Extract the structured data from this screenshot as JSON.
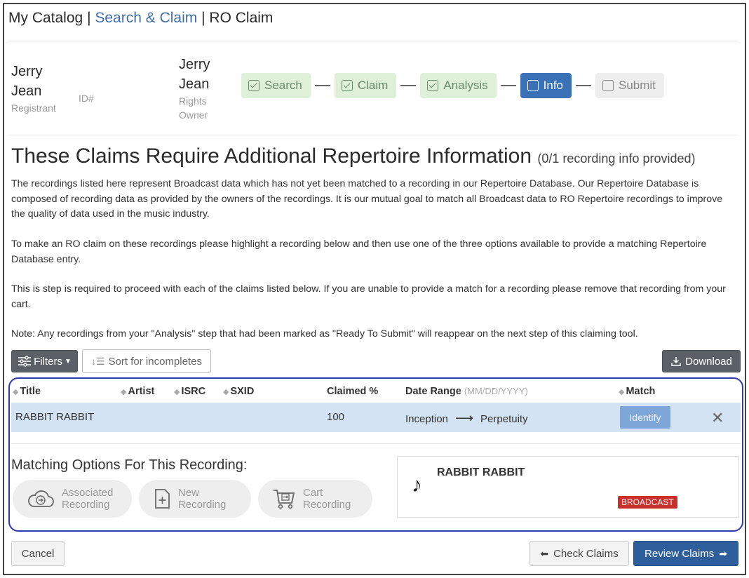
{
  "breadcrumb": {
    "root": "My Catalog",
    "sep1": "|",
    "middle": "Search & Claim",
    "sep2": "|",
    "current": "RO Claim"
  },
  "registrant": {
    "first": "Jerry",
    "last": "Jean",
    "role": "Registrant",
    "id_label": "ID#"
  },
  "rights_owner": {
    "first": "Jerry",
    "last": "Jean",
    "role_line1": "Rights",
    "role_line2": "Owner"
  },
  "steps": [
    {
      "label": "Search",
      "state": "done"
    },
    {
      "label": "Claim",
      "state": "done"
    },
    {
      "label": "Analysis",
      "state": "done"
    },
    {
      "label": "Info",
      "state": "active"
    },
    {
      "label": "Submit",
      "state": "todo"
    }
  ],
  "heading": {
    "title": "These Claims Require Additional Repertoire Information",
    "count": "(0/1 recording info provided)"
  },
  "paragraphs": [
    "The recordings listed here represent Broadcast data which has not yet been matched to a recording in our Repertoire Database. Our Repertoire Database is composed of recording data as provided by the owners of the recordings. It is our mutual goal to match all Broadcast data to RO Repertoire recordings to improve the quality of data used in the music industry.",
    "To make an RO claim on these recordings please highlight a recording below and then use one of the three options available to provide a matching Repertoire Database entry.",
    "This is step is required to proceed with each of the claims listed below. If you are unable to provide a match for a recording please remove that recording from your cart.",
    "Note: Any recordings from your \"Analysis\" step that had been marked as \"Ready To Submit\" will reappear on the next step of this claiming tool."
  ],
  "toolbar": {
    "filters": "Filters",
    "sort": "Sort for incompletes",
    "download": "Download"
  },
  "table": {
    "columns": {
      "title": "Title",
      "artist": "Artist",
      "isrc": "ISRC",
      "sxid": "SXID",
      "claimed": "Claimed %",
      "date_range": "Date Range",
      "date_format": "(MM/DD/YYYY)",
      "match": "Match"
    },
    "rows": [
      {
        "title": "RABBIT RABBIT",
        "artist": "",
        "isrc": "",
        "sxid": "",
        "claimed": "100",
        "date_from": "Inception",
        "date_to": "Perpetuity",
        "match_button": "Identify"
      }
    ]
  },
  "matching": {
    "title": "Matching Options For This Recording:",
    "options": [
      {
        "line1": "Associated",
        "line2": "Recording",
        "icon": "cloud-arrow-icon"
      },
      {
        "line1": "New",
        "line2": "Recording",
        "icon": "document-plus-icon"
      },
      {
        "line1": "Cart",
        "line2": "Recording",
        "icon": "cart-icon"
      }
    ],
    "card": {
      "title": "RABBIT RABBIT",
      "badge": "BROADCAST",
      "icon": "music-note-icon"
    }
  },
  "footer": {
    "cancel": "Cancel",
    "check": "Check Claims",
    "review": "Review Claims"
  },
  "colors": {
    "accent_blue": "#3a70b6",
    "done_green": "#dff0d8",
    "outline": "#2c3bb0",
    "badge_red": "#c9302c",
    "row_highlight": "#d4e3f3"
  }
}
